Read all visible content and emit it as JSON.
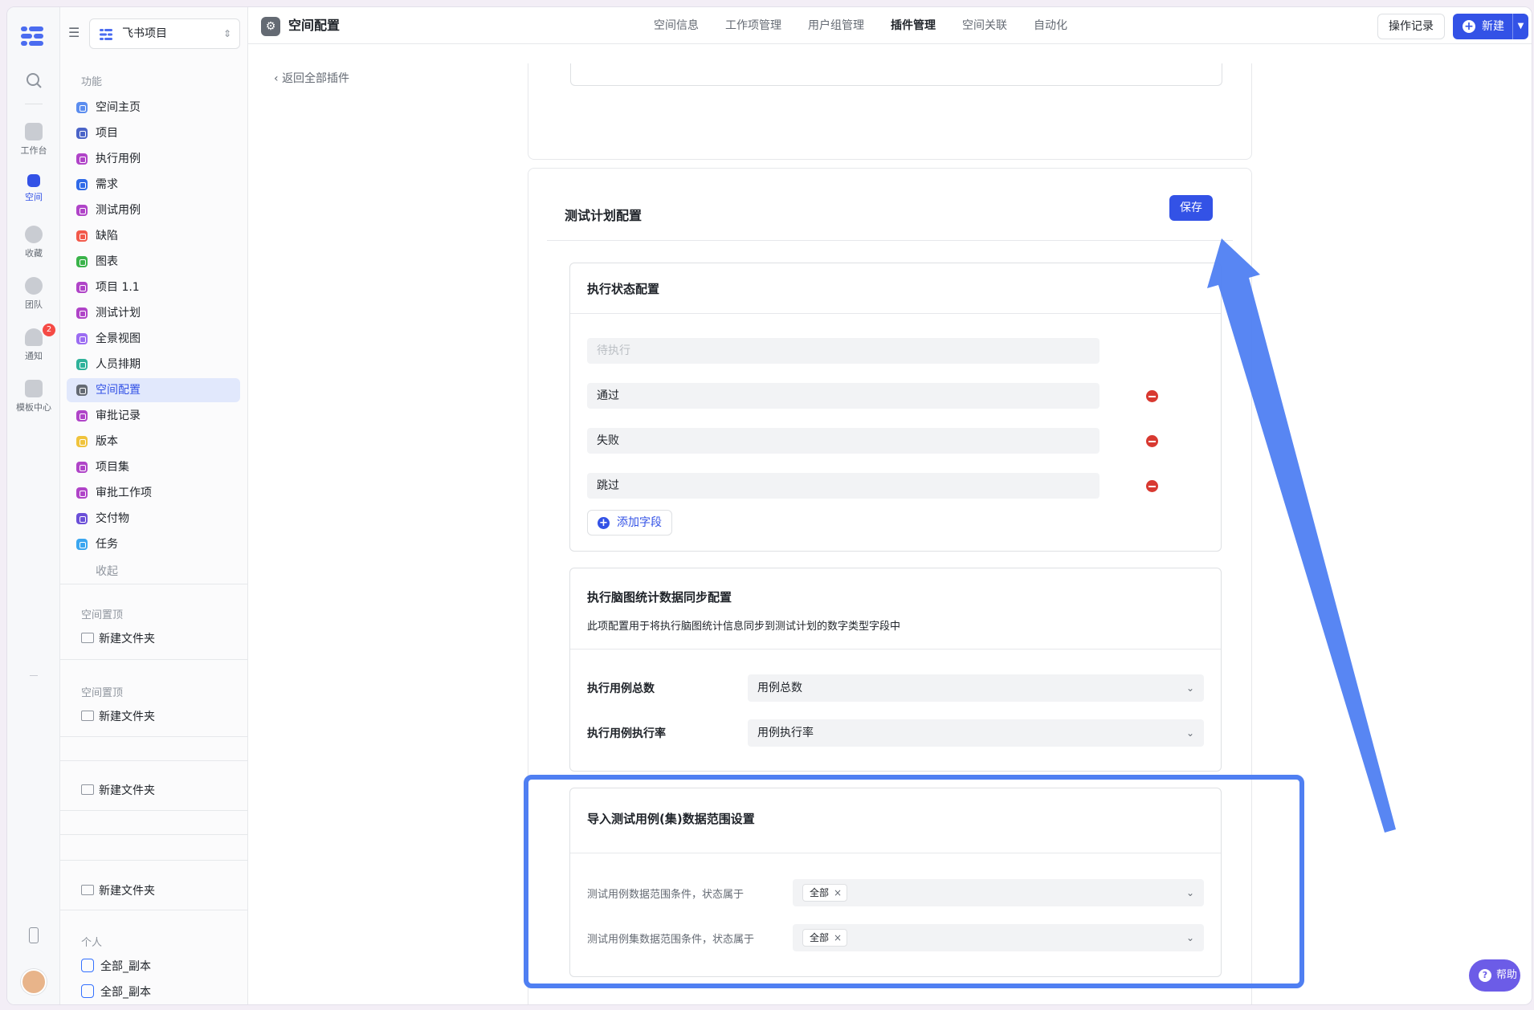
{
  "rail": {
    "items": [
      {
        "label": ""
      },
      {
        "label": "工作台"
      },
      {
        "label": "空间"
      },
      {
        "label": "收藏"
      },
      {
        "label": "团队"
      },
      {
        "label": "通知"
      },
      {
        "label": "模板中心"
      }
    ],
    "notify_count": "2"
  },
  "sidebar": {
    "space_name": "飞书项目",
    "section_features": "功能",
    "items": [
      {
        "label": "空间主页",
        "color": "#5b8def"
      },
      {
        "label": "项目",
        "color": "#4b64c8"
      },
      {
        "label": "执行用例",
        "color": "#b044c8"
      },
      {
        "label": "需求",
        "color": "#2f6ae8"
      },
      {
        "label": "测试用例",
        "color": "#b044c8"
      },
      {
        "label": "缺陷",
        "color": "#f2594b"
      },
      {
        "label": "图表",
        "color": "#3ab34a"
      },
      {
        "label": "项目 1.1",
        "color": "#b044c8"
      },
      {
        "label": "测试计划",
        "color": "#b044c8"
      },
      {
        "label": "全景视图",
        "color": "#9b6cf2"
      },
      {
        "label": "人员排期",
        "color": "#2fb29a"
      },
      {
        "label": "空间配置",
        "color": "#646a73"
      },
      {
        "label": "审批记录",
        "color": "#b044c8"
      },
      {
        "label": "版本",
        "color": "#f0c33c"
      },
      {
        "label": "项目集",
        "color": "#b044c8"
      },
      {
        "label": "审批工作项",
        "color": "#b044c8"
      },
      {
        "label": "交付物",
        "color": "#6b4fd8"
      },
      {
        "label": "任务",
        "color": "#3aa6f0"
      }
    ],
    "collapse_label": "收起",
    "pinned_title_1": "空间置顶",
    "folder_1": "新建文件夹",
    "pinned_title_2": "空间置顶",
    "folder_2": "新建文件夹",
    "folder_3": "新建文件夹",
    "folder_4": "新建文件夹",
    "personal_title": "个人",
    "docs": [
      "全部_副本",
      "全部_副本"
    ]
  },
  "topbar": {
    "title": "空间配置",
    "tabs": [
      "空间信息",
      "工作项管理",
      "用户组管理",
      "插件管理",
      "空间关联",
      "自动化"
    ],
    "active_tab": "插件管理",
    "log_button": "操作记录",
    "new_button": "新建"
  },
  "content": {
    "back_label": "返回全部插件",
    "plan_title": "测试计划配置",
    "save_button": "保存",
    "exec_status": {
      "title": "执行状态配置",
      "fields": [
        "待执行",
        "通过",
        "失败",
        "跳过"
      ],
      "add_button": "添加字段"
    },
    "sync": {
      "title": "执行脑图统计数据同步配置",
      "desc": "此项配置用于将执行脑图统计信息同步到测试计划的数字类型字段中",
      "rows": [
        {
          "label": "执行用例总数",
          "value": "用例总数"
        },
        {
          "label": "执行用例执行率",
          "value": "用例执行率"
        }
      ]
    },
    "import_scope": {
      "title": "导入测试用例(集)数据范围设置",
      "rows": [
        {
          "label": "测试用例数据范围条件，状态属于",
          "tag": "全部"
        },
        {
          "label": "测试用例集数据范围条件，状态属于",
          "tag": "全部"
        }
      ]
    }
  },
  "help": "帮助",
  "colors": {
    "accent": "#3352e6",
    "highlight": "#4f7ff2",
    "danger": "#d83931"
  }
}
